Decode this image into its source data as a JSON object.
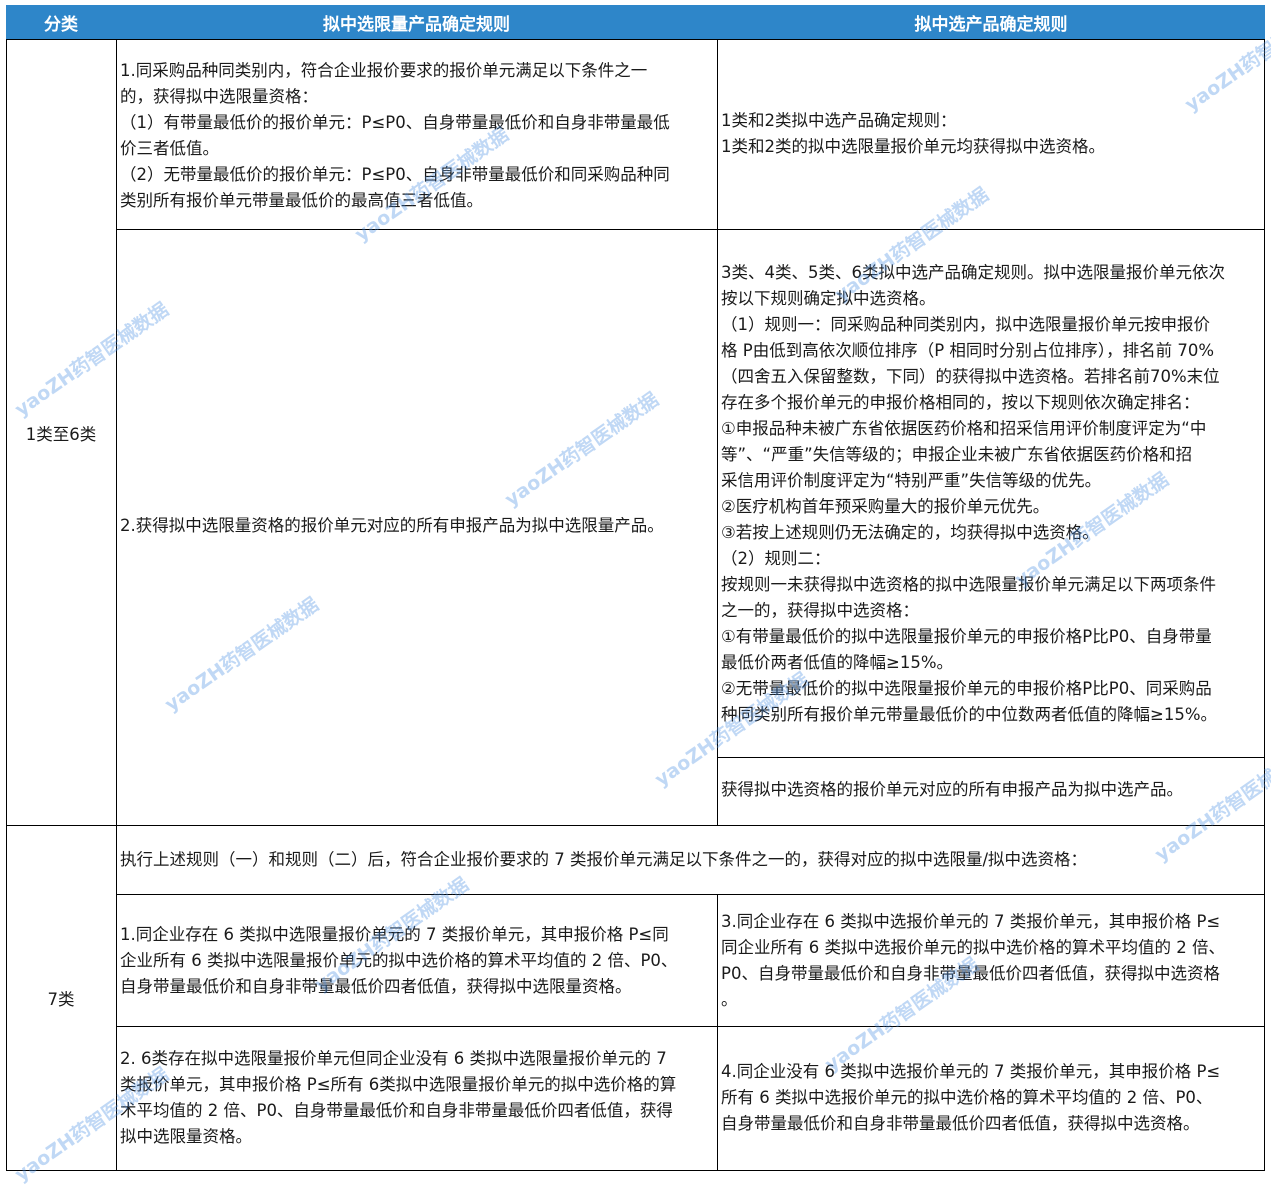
{
  "header": {
    "col1": "分类",
    "col2": "拟中选限量产品确定规则",
    "col3": "拟中选产品确定规则"
  },
  "rows": {
    "cat_1_6": "1类至6类",
    "cat_7": "7类",
    "r1_left": "1.同采购品种同类别内，符合企业报价要求的报价单元满足以下条件之一\n的，获得拟中选限量资格：\n（1）有带量最低价的报价单元：P≤P0、自身带量最低价和自身非带量最低\n价三者低值。\n（2）无带量最低价的报价单元：P≤P0、自身非带量最低价和同采购品种同\n类别所有报价单元带量最低价的最高值三者低值。",
    "r1_right": "1类和2类拟中选产品确定规则：\n1类和2类的拟中选限量报价单元均获得拟中选资格。",
    "r2_left": "2.获得拟中选限量资格的报价单元对应的所有申报产品为拟中选限量产品。",
    "r2_right_a": "3类、4类、5类、6类拟中选产品确定规则。拟中选限量报价单元依次\n按以下规则确定拟中选资格。\n（1）规则一：同采购品种同类别内，拟中选限量报价单元按申报价\n格 P由低到高依次顺位排序（P 相同时分别占位排序），排名前 70%\n（四舍五入保留整数，下同）的获得拟中选资格。若排名前70%末位\n存在多个报价单元的申报价格相同的，按以下规则依次确定排名：\n①申报品种未被广东省依据医药价格和招采信用评价制度评定为“中\n等”、“严重”失信等级的；申报企业未被广东省依据医药价格和招\n采信用评价制度评定为“特别严重”失信等级的优先。\n②医疗机构首年预采购量大的报价单元优先。\n③若按上述规则仍无法确定的，均获得拟中选资格。\n（2）规则二：\n按规则一未获得拟中选资格的拟中选限量报价单元满足以下两项条件\n之一的，获得拟中选资格：\n①有带量最低价的拟中选限量报价单元的申报价格P比P0、自身带量\n最低价两者低值的降幅≥15%。\n②无带量最低价的拟中选限量报价单元的申报价格P比P0、同采购品\n种同类别所有报价单元带量最低价的中位数两者低值的降幅≥15%。",
    "r2_right_b": "获得拟中选资格的报价单元对应的所有申报产品为拟中选产品。",
    "r3_span": "执行上述规则（一）和规则（二）后，符合企业报价要求的 7 类报价单元满足以下条件之一的，获得对应的拟中选限量/拟中选资格：",
    "r4_left": "1.同企业存在 6 类拟中选限量报价单元的 7 类报价单元，其申报价格 P≤同\n企业所有 6 类拟中选限量报价单元的拟中选价格的算术平均值的 2 倍、P0、\n自身带量最低价和自身非带量最低价四者低值，获得拟中选限量资格。",
    "r4_right": "3.同企业存在 6 类拟中选报价单元的 7 类报价单元，其申报价格 P≤\n同企业所有 6 类拟中选报价单元的拟中选价格的算术平均值的 2 倍、\nP0、自身带量最低价和自身非带量最低价四者低值，获得拟中选资格\n。",
    "r5_left": "2. 6类存在拟中选限量报价单元但同企业没有 6 类拟中选限量报价单元的 7\n类报价单元，其申报价格 P≤所有 6类拟中选限量报价单元的拟中选价格的算\n术平均值的 2 倍、P0、自身带量最低价和自身非带量最低价四者低值，获得\n拟中选限量资格。",
    "r5_right": "4.同企业没有 6 类拟中选报价单元的 7 类报价单元，其申报价格 P≤\n所有 6 类拟中选报价单元的拟中选价格的算术平均值的 2 倍、P0、\n自身带量最低价和自身非带量最低价四者低值，获得拟中选资格。"
  },
  "watermark": "yaoZH药智医械数据",
  "colors": {
    "header_bg": "#2e86c9",
    "header_text": "#ffffff",
    "grid": "#000000",
    "watermark": "#4a90e2"
  }
}
